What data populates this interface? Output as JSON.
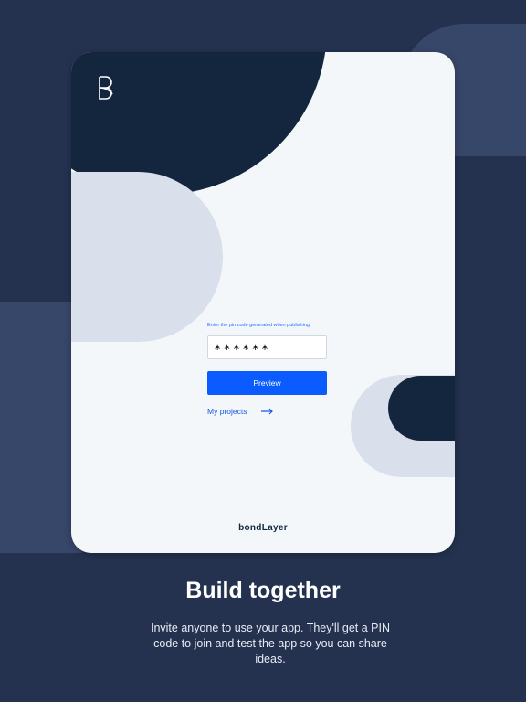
{
  "tablet": {
    "pin_label": "Enter the pin code generated when publishing",
    "pin_value": "∗∗∗∗∗∗",
    "preview_label": "Preview",
    "projects_label": "My projects",
    "brand": "bondLayer",
    "icons": [
      "bondlayer-logo-icon",
      "arrow-right-icon"
    ]
  },
  "headline": "Build together",
  "description": "Invite anyone to use your app. They'll get a PIN code to join and test the app so you can share ideas.",
  "colors": {
    "background": "#243250",
    "accent": "#0a5cff",
    "dark_navy": "#14263d",
    "light_grey": "#d9dfeb"
  }
}
